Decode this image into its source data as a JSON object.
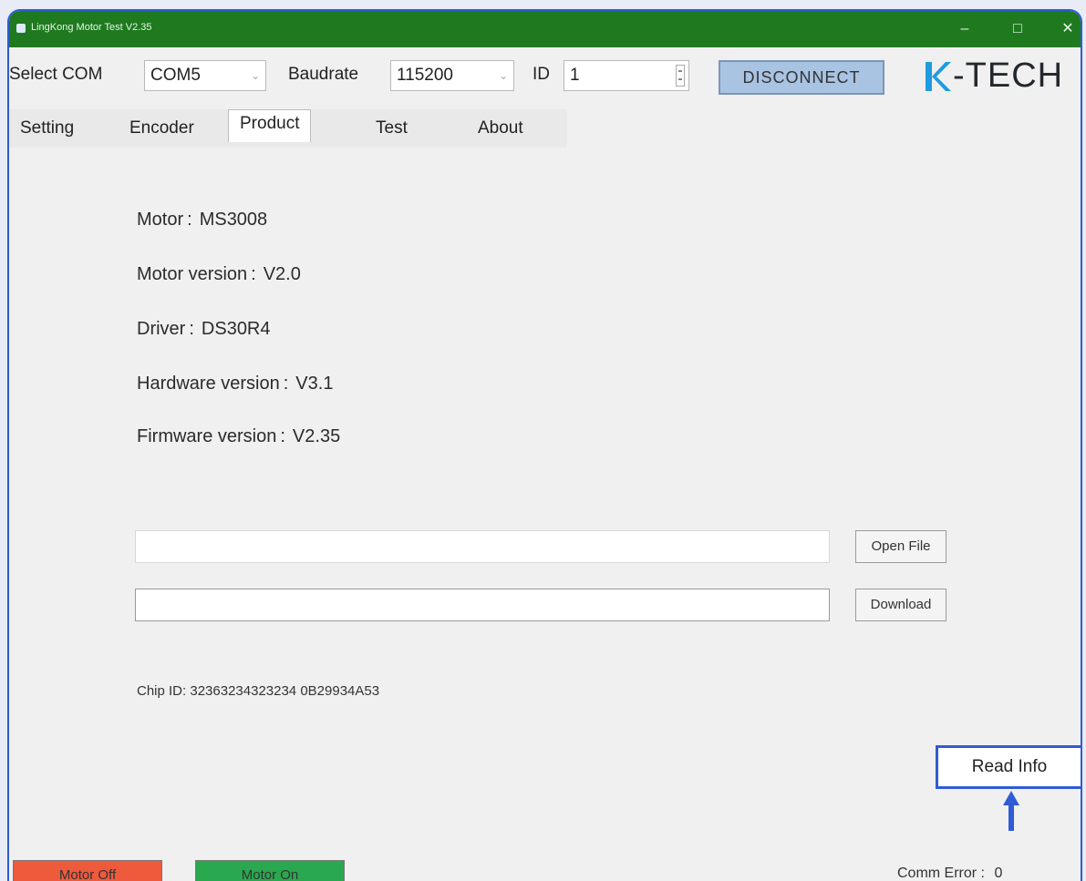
{
  "window": {
    "title": "LingKong Motor Test V2.35",
    "controls": {
      "minimize": "–",
      "maximize": "□",
      "close": "✕"
    }
  },
  "toolbar": {
    "select_com_label": "Select COM",
    "com_value": "COM5",
    "baudrate_label": "Baudrate",
    "baudrate_value": "115200",
    "id_label": "ID",
    "id_value": "1",
    "disconnect_label": "DISCONNECT",
    "logo_text": "-TECH"
  },
  "tabs": [
    {
      "label": "Setting"
    },
    {
      "label": "Encoder"
    },
    {
      "label": "Product"
    },
    {
      "label": "Test"
    },
    {
      "label": "About"
    }
  ],
  "active_tab": "Product",
  "product": {
    "info": [
      {
        "label": "Motor",
        "value": "MS3008"
      },
      {
        "label": "Motor version",
        "value": "V2.0"
      },
      {
        "label": "Driver",
        "value": "DS30R4"
      },
      {
        "label": "Hardware version",
        "value": "V3.1"
      },
      {
        "label": "Firmware version",
        "value": "V2.35"
      }
    ],
    "separator": ":",
    "file_path": "",
    "download_path": "",
    "open_file_label": "Open File",
    "download_label": "Download",
    "chip_id_label": "Chip ID:",
    "chip_id_value": "32363234323234 0B29934A53",
    "read_info_label": "Read Info"
  },
  "status": {
    "motor_off_label": "Motor Off",
    "motor_on_label": "Motor On",
    "comm_error_label": "Comm Error :",
    "comm_error_value": "0"
  },
  "colors": {
    "titlebar": "#1f7a1f",
    "highlight": "#2f5bd6",
    "motor_off": "#ee5a3c",
    "motor_on": "#2aa84f",
    "disconnect": "#a9c3e2"
  },
  "icons": [
    "app-icon",
    "minimize-icon",
    "maximize-icon",
    "close-icon",
    "dropdown-arrow-icon",
    "spinner-icon",
    "k-tech-logo",
    "up-arrow-icon"
  ]
}
